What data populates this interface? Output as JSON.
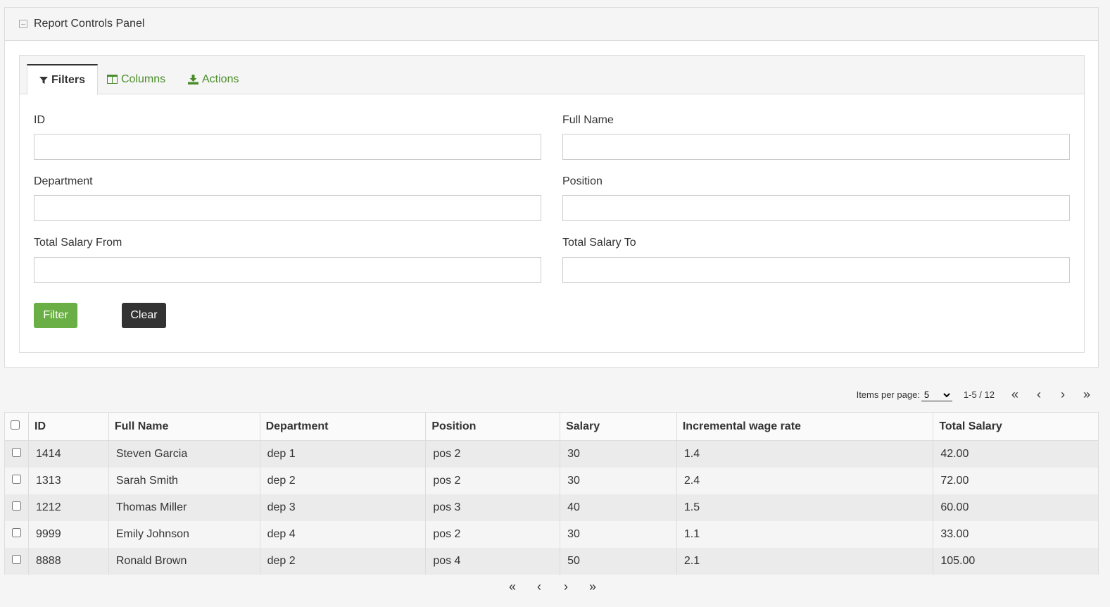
{
  "panel": {
    "title": "Report Controls Panel"
  },
  "tabs": [
    {
      "label": "Filters",
      "icon": "filter-icon"
    },
    {
      "label": "Columns",
      "icon": "columns-icon"
    },
    {
      "label": "Actions",
      "icon": "download-icon"
    }
  ],
  "filters": {
    "id_label": "ID",
    "full_name_label": "Full Name",
    "department_label": "Department",
    "position_label": "Position",
    "salary_from_label": "Total Salary From",
    "salary_to_label": "Total Salary To",
    "filter_button": "Filter",
    "clear_button": "Clear"
  },
  "pager": {
    "items_per_page_label": "Items per page:",
    "items_per_page_value": "5",
    "range": "1-5 / 12",
    "first": "«",
    "prev": "‹",
    "next": "›",
    "last": "»"
  },
  "table": {
    "headers": [
      "ID",
      "Full Name",
      "Department",
      "Position",
      "Salary",
      "Incremental wage rate",
      "Total Salary"
    ],
    "rows": [
      [
        "1414",
        "Steven Garcia",
        "dep 1",
        "pos 2",
        "30",
        "1.4",
        "42.00"
      ],
      [
        "1313",
        "Sarah Smith",
        "dep 2",
        "pos 2",
        "30",
        "2.4",
        "72.00"
      ],
      [
        "1212",
        "Thomas Miller",
        "dep 3",
        "pos 3",
        "40",
        "1.5",
        "60.00"
      ],
      [
        "9999",
        "Emily Johnson",
        "dep 4",
        "pos 2",
        "30",
        "1.1",
        "33.00"
      ],
      [
        "8888",
        "Ronald Brown",
        "dep 2",
        "pos 4",
        "50",
        "2.1",
        "105.00"
      ]
    ]
  },
  "colors": {
    "accent": "#6aaf45",
    "tab_link": "#4a8c2a",
    "dark": "#333333"
  }
}
